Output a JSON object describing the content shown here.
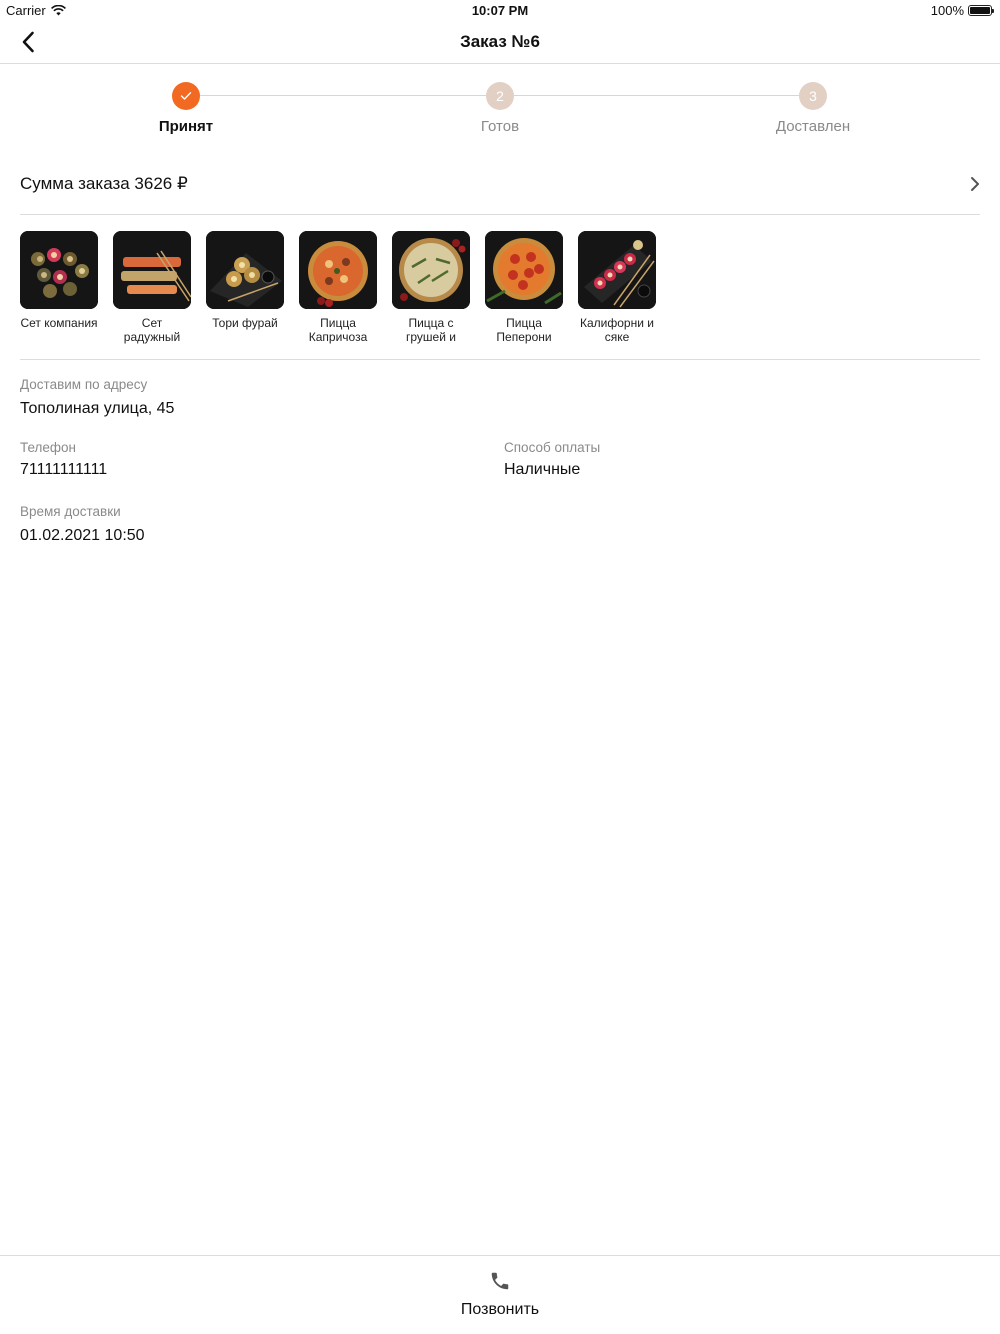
{
  "status_bar": {
    "carrier": "Carrier",
    "time": "10:07 PM",
    "battery": "100%",
    "battery_level": 1.0
  },
  "nav": {
    "title": "Заказ №6"
  },
  "stepper": {
    "accent_color": "#f26a21",
    "inactive_color": "#e2d0c5",
    "steps": [
      {
        "label": "Принят",
        "state": "done",
        "marker": "✓"
      },
      {
        "label": "Готов",
        "state": "todo",
        "marker": "2"
      },
      {
        "label": "Доставлен",
        "state": "todo",
        "marker": "3"
      }
    ]
  },
  "order": {
    "sum_label": "Сумма заказа 3626 ₽"
  },
  "products": [
    {
      "name": "Сет компания",
      "icon": "sushi-set-image"
    },
    {
      "name": "Сет радужный",
      "icon": "sushi-set-image"
    },
    {
      "name": "Тори фурай",
      "icon": "sushi-rolls-image"
    },
    {
      "name": "Пицца Капричоза",
      "icon": "pizza-image"
    },
    {
      "name": "Пицца с грушей и",
      "icon": "pizza-image"
    },
    {
      "name": "Пицца Пеперони",
      "icon": "pizza-image"
    },
    {
      "name": "Калифорни и сяке",
      "icon": "sushi-rolls-image"
    }
  ],
  "details": {
    "address_label": "Доставим по адресу",
    "address_value": "Тополиная улица, 45",
    "phone_label": "Телефон",
    "phone_value": "71111111111",
    "payment_label": "Способ оплаты",
    "payment_value": "Наличные",
    "time_label": "Время доставки",
    "time_value": "01.02.2021 10:50"
  },
  "bottom": {
    "call_label": "Позвонить",
    "call_icon": "phone-icon"
  }
}
